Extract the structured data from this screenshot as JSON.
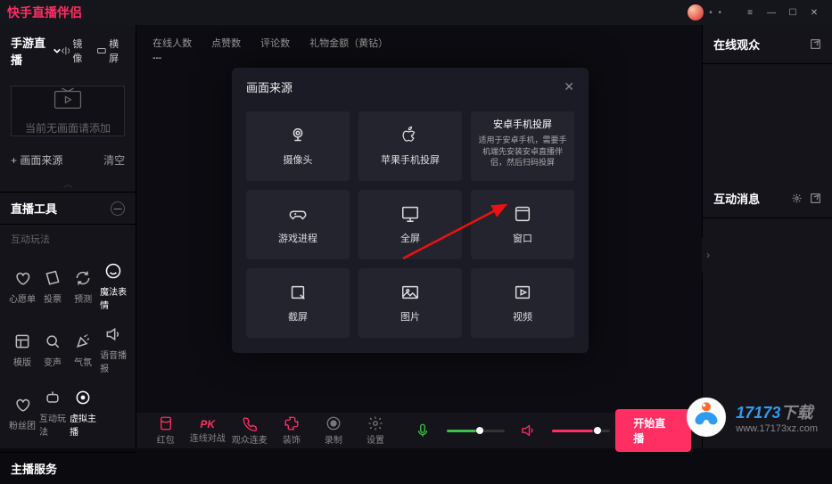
{
  "app_title": "快手直播伴侣",
  "titlebar_dots": "• •",
  "sidebar": {
    "mode_label": "手游直播",
    "mirror_label": "镜像",
    "orient_label": "横屏",
    "preview_empty": "当前无画面请添加",
    "add_source": "+ 画面来源",
    "clear_label": "清空",
    "tools_header": "直播工具",
    "tools_sub": "互动玩法",
    "tools": [
      {
        "label": "心愿单"
      },
      {
        "label": "投票"
      },
      {
        "label": "预测"
      },
      {
        "label": "魔法表情"
      },
      {
        "label": "模版"
      },
      {
        "label": "变声"
      },
      {
        "label": "气氛"
      },
      {
        "label": "语音播报"
      },
      {
        "label": "粉丝团"
      },
      {
        "label": "互动玩法"
      },
      {
        "label": "虚拟主播"
      }
    ],
    "service_header": "主播服务"
  },
  "stats": {
    "online": {
      "label": "在线人数",
      "value": "---"
    },
    "likes": {
      "label": "点赞数",
      "value": ""
    },
    "comments": {
      "label": "评论数",
      "value": ""
    },
    "gifts": {
      "label": "礼物金额（黄钻）",
      "value": ""
    }
  },
  "modal": {
    "title": "画面来源",
    "cards": {
      "camera": "摄像头",
      "apple_cast": "苹果手机投屏",
      "android_title": "安卓手机投屏",
      "android_desc": "适用于安卓手机，需要手机端先安装安卓直播伴侣，然后扫码投屏",
      "game": "游戏进程",
      "fullscreen": "全屏",
      "window": "窗口",
      "capture": "截屏",
      "image": "图片",
      "video": "视频"
    }
  },
  "bottom": {
    "redpacket": "红包",
    "pk": "PK",
    "linkpk": "连线对战",
    "audience_link": "观众连麦",
    "decor": "装饰",
    "record": "录制",
    "settings": "设置",
    "start": "开始直播"
  },
  "right": {
    "viewers_header": "在线观众",
    "msgs_header": "互动消息"
  },
  "watermark": {
    "line1a": "17173",
    "line1b": "下载",
    "line2": "www.17173xz.com"
  }
}
